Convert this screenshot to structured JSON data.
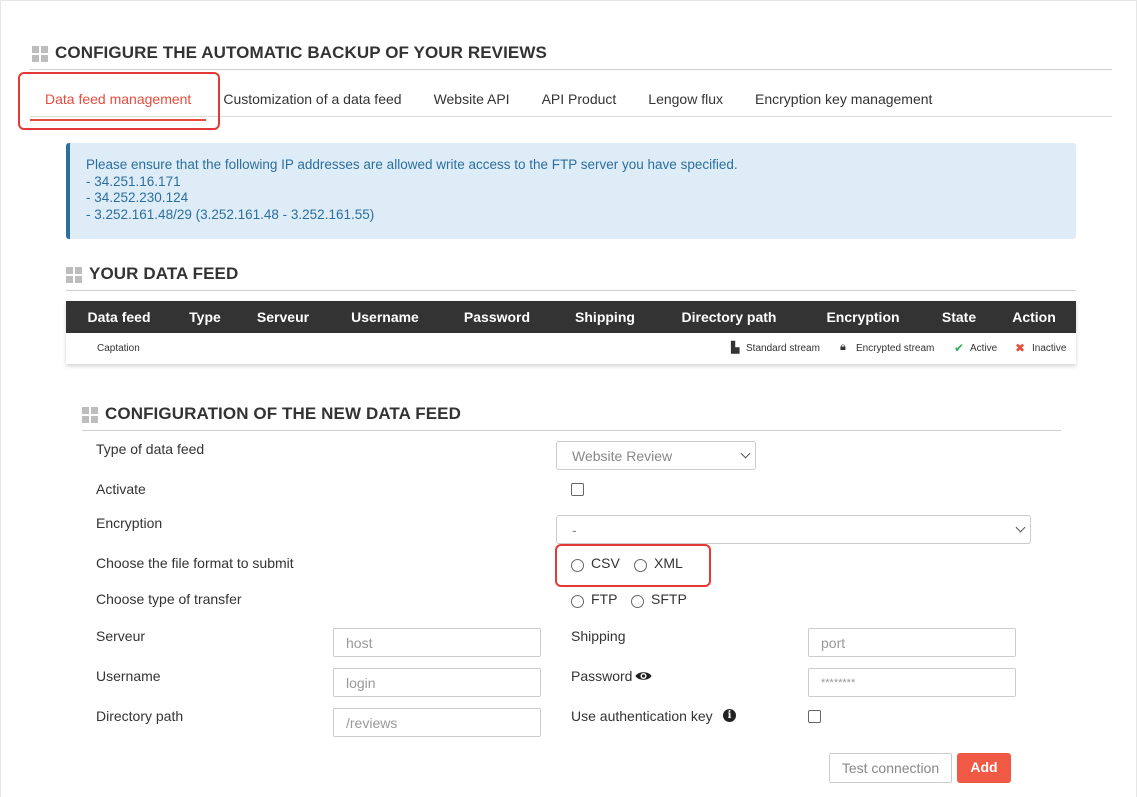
{
  "header": {
    "title": "CONFIGURE THE AUTOMATIC BACKUP OF YOUR REVIEWS"
  },
  "tabs": [
    {
      "label": "Data feed management",
      "active": true
    },
    {
      "label": "Customization of a data feed"
    },
    {
      "label": "Website API"
    },
    {
      "label": "API Product"
    },
    {
      "label": "Lengow flux"
    },
    {
      "label": "Encryption key management"
    }
  ],
  "alert": {
    "intro": "Please ensure that the following IP addresses are allowed write access to the FTP server you have specified.",
    "ips": [
      "- 34.251.16.171",
      "- 34.252.230.124",
      "- 3.252.161.48/29 (3.252.161.48 - 3.252.161.55)"
    ]
  },
  "data_feed": {
    "title": "YOUR DATA FEED",
    "columns": [
      "Data feed",
      "Type",
      "Serveur",
      "Username",
      "Password",
      "Shipping",
      "Directory path",
      "Encryption",
      "State",
      "Action"
    ],
    "legend": {
      "caption": "Captation",
      "standard": "Standard stream",
      "encrypted": "Encrypted stream",
      "active": "Active",
      "inactive": "Inactive"
    }
  },
  "config": {
    "title": "CONFIGURATION OF THE NEW DATA FEED",
    "type_label": "Type of data feed",
    "type_value": "Website Review",
    "activate_label": "Activate",
    "encryption_label": "Encryption",
    "encryption_value": "-",
    "format_label": "Choose the file format to submit",
    "format_options": [
      "CSV",
      "XML"
    ],
    "transfer_label": "Choose type of transfer",
    "transfer_options": [
      "FTP",
      "SFTP"
    ],
    "server_label": "Serveur",
    "server_placeholder": "host",
    "username_label": "Username",
    "username_placeholder": "login",
    "directory_label": "Directory path",
    "directory_placeholder": "/reviews",
    "shipping_label": "Shipping",
    "shipping_placeholder": "port",
    "password_label": "Password",
    "password_placeholder": "********",
    "auth_label": "Use authentication key",
    "test_button": "Test connection",
    "add_button": "Add"
  },
  "colors": {
    "accent": "#e74c3c",
    "alert_bg": "#deecf7",
    "alert_text": "#2b6f9e",
    "table_header": "#333333",
    "add_button": "#f05a45"
  }
}
